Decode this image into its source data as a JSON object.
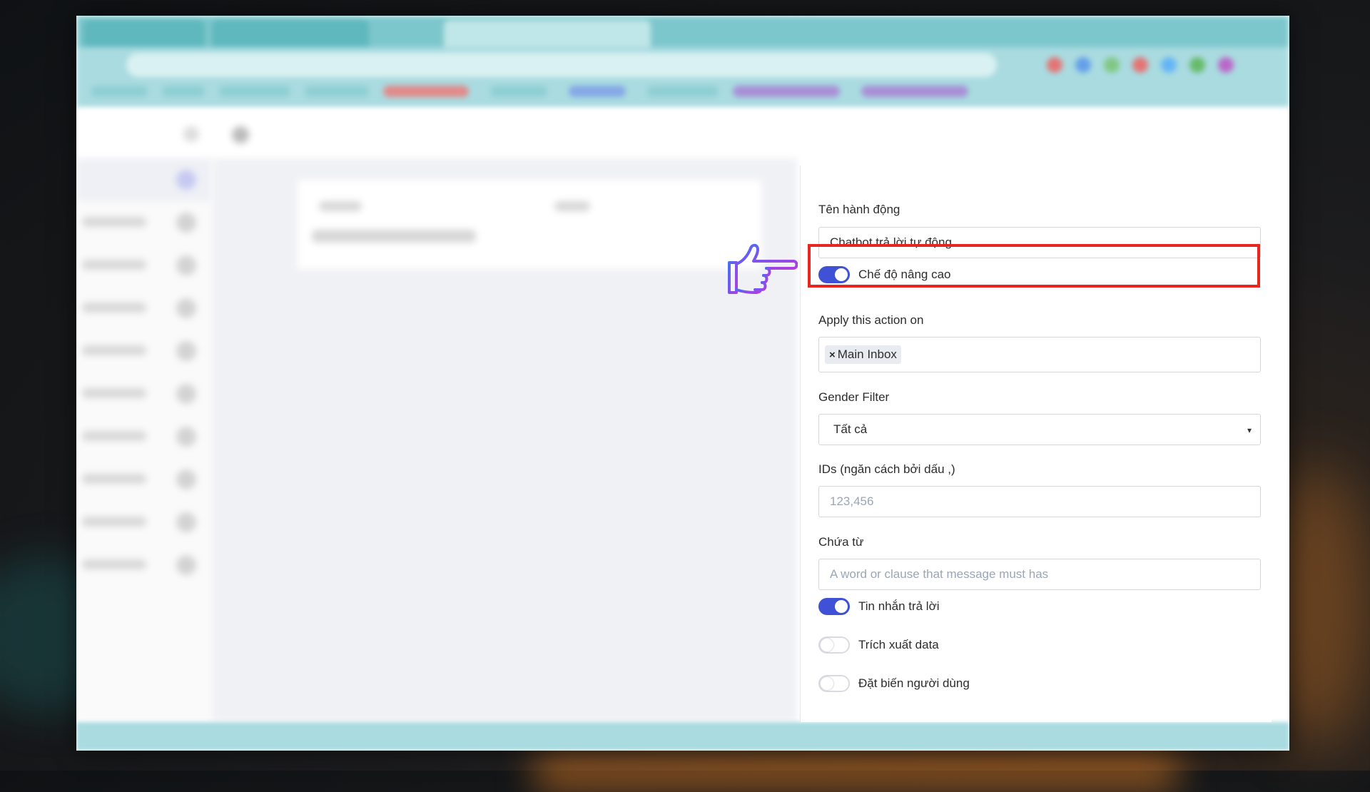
{
  "colors": {
    "accent": "#3f51d6",
    "highlight": "#e9251f",
    "chrome": "#a9dbe0",
    "pointer_start": "#4a6cf7",
    "pointer_end": "#b23ce0"
  },
  "form": {
    "action_name_label": "Tên hành động",
    "action_name_value": "Chatbot trả lời tự động",
    "advanced_mode": {
      "label": "Chế độ nâng cao",
      "on": true
    },
    "apply_label": "Apply this action on",
    "apply_chips": [
      {
        "label": "Main Inbox",
        "remove_icon": "×"
      }
    ],
    "gender_label": "Gender Filter",
    "gender_value": "Tất cả",
    "gender_caret": "▾",
    "ids_label": "IDs (ngăn cách bởi dấu ,)",
    "ids_placeholder": "123,456",
    "contains_label": "Chứa từ",
    "contains_placeholder": "A word or clause that message must has",
    "toggles": [
      {
        "label": "Tin nhắn trả lời",
        "on": true
      },
      {
        "label": "Trích xuất data",
        "on": false
      },
      {
        "label": "Đặt biến người dùng",
        "on": false
      }
    ]
  },
  "annotation": {
    "icon": "pointing-hand-icon"
  }
}
